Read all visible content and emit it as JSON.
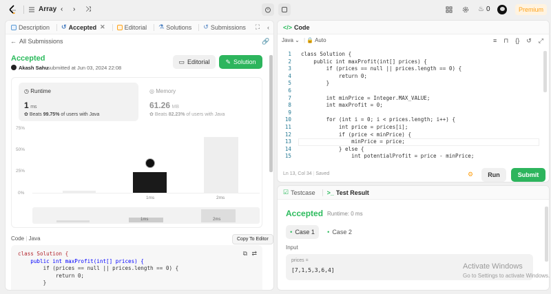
{
  "topbar": {
    "problem_list": "Array",
    "coins": "0",
    "premium": "Premium"
  },
  "left_panel": {
    "tabs": [
      "Description",
      "Accepted",
      "Editorial",
      "Solutions",
      "Submissions"
    ],
    "back_link": "All Submissions",
    "status": "Accepted",
    "user": "Akash Sahu",
    "submitted_at": "submitted at Jun 03, 2024 22:08",
    "editorial_btn": "Editorial",
    "solution_btn": "Solution",
    "runtime": {
      "label": "Runtime",
      "value": "1",
      "unit": "ms",
      "beats_prefix": "Beats",
      "beats_pct": "99.75%",
      "beats_suffix": "of users with Java"
    },
    "memory": {
      "label": "Memory",
      "value": "61.26",
      "unit": "MB",
      "beats_prefix": "Beats",
      "beats_pct": "82.23%",
      "beats_suffix": "of users with Java"
    },
    "chart": {
      "y_ticks": [
        "75%",
        "50%",
        "25%",
        "0%"
      ],
      "x_labels": [
        "1ms",
        "2ms"
      ],
      "mini_labels": [
        "1ms",
        "2ms"
      ]
    },
    "code_header": "Code",
    "code_lang": "Java",
    "tooltip": "Copy To Editor",
    "code_lines": [
      "class Solution {",
      "    public int maxProfit(int[] prices) {",
      "        if (prices == null || prices.length == 0) {",
      "            return 0;",
      "        }"
    ]
  },
  "code_panel": {
    "title": "Code",
    "language": "Java",
    "auto": "Auto",
    "cursor": "Ln 13, Col 34",
    "saved": "Saved",
    "run": "Run",
    "submit": "Submit",
    "lines": [
      {
        "n": "1",
        "t": "class Solution {"
      },
      {
        "n": "2",
        "t": "    public int maxProfit(int[] prices) {"
      },
      {
        "n": "3",
        "t": "        if (prices == null || prices.length == 0) {"
      },
      {
        "n": "4",
        "t": "            return 0;"
      },
      {
        "n": "5",
        "t": "        }"
      },
      {
        "n": "6",
        "t": ""
      },
      {
        "n": "7",
        "t": "        int minPrice = Integer.MAX_VALUE;"
      },
      {
        "n": "8",
        "t": "        int maxProfit = 0;"
      },
      {
        "n": "9",
        "t": ""
      },
      {
        "n": "10",
        "t": "        for (int i = 0; i < prices.length; i++) {"
      },
      {
        "n": "11",
        "t": "            int price = prices[i];"
      },
      {
        "n": "12",
        "t": "            if (price < minPrice) {"
      },
      {
        "n": "13",
        "t": "                minPrice = price;"
      },
      {
        "n": "14",
        "t": "            } else {"
      },
      {
        "n": "15",
        "t": "                int potentialProfit = price - minPrice;"
      }
    ]
  },
  "result_panel": {
    "tab_testcase": "Testcase",
    "tab_result": "Test Result",
    "status": "Accepted",
    "runtime": "Runtime: 0 ms",
    "case1": "Case 1",
    "case2": "Case 2",
    "input_label": "Input",
    "input_name": "prices =",
    "input_value": "[7,1,5,3,6,4]"
  },
  "watermark": {
    "title": "Activate Windows",
    "subtitle": "Go to Settings to activate Windows."
  },
  "colors": {
    "accent_green": "#2db55d",
    "accepted_green": "#2cbb5d",
    "premium": "#ffa116"
  }
}
